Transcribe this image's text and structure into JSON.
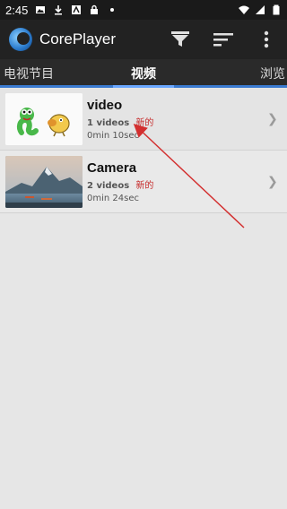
{
  "status_bar": {
    "time": "2:45",
    "icons": [
      "image-icon",
      "download-icon",
      "app-icon",
      "lock-icon",
      "dot-icon"
    ],
    "right_icons": [
      "wifi-icon",
      "cell-signal-icon",
      "battery-icon"
    ]
  },
  "app_bar": {
    "title": "CorePlayer",
    "actions": [
      "filter-icon",
      "sort-icon",
      "more-icon"
    ]
  },
  "tabs": {
    "left": "电视节目",
    "active": "视频",
    "right": "浏览"
  },
  "colors": {
    "accent": "#3a7ad0",
    "new_label": "#c62828",
    "annotation_arrow": "#d32f2f"
  },
  "items": [
    {
      "title": "video",
      "count": "1 videos",
      "new_label": "新的",
      "duration": "0min 10sec",
      "thumb": "cartoon-thumbnail"
    },
    {
      "title": "Camera",
      "count": "2 videos",
      "new_label": "新的",
      "duration": "0min 24sec",
      "thumb": "mountain-lake-thumbnail"
    }
  ]
}
